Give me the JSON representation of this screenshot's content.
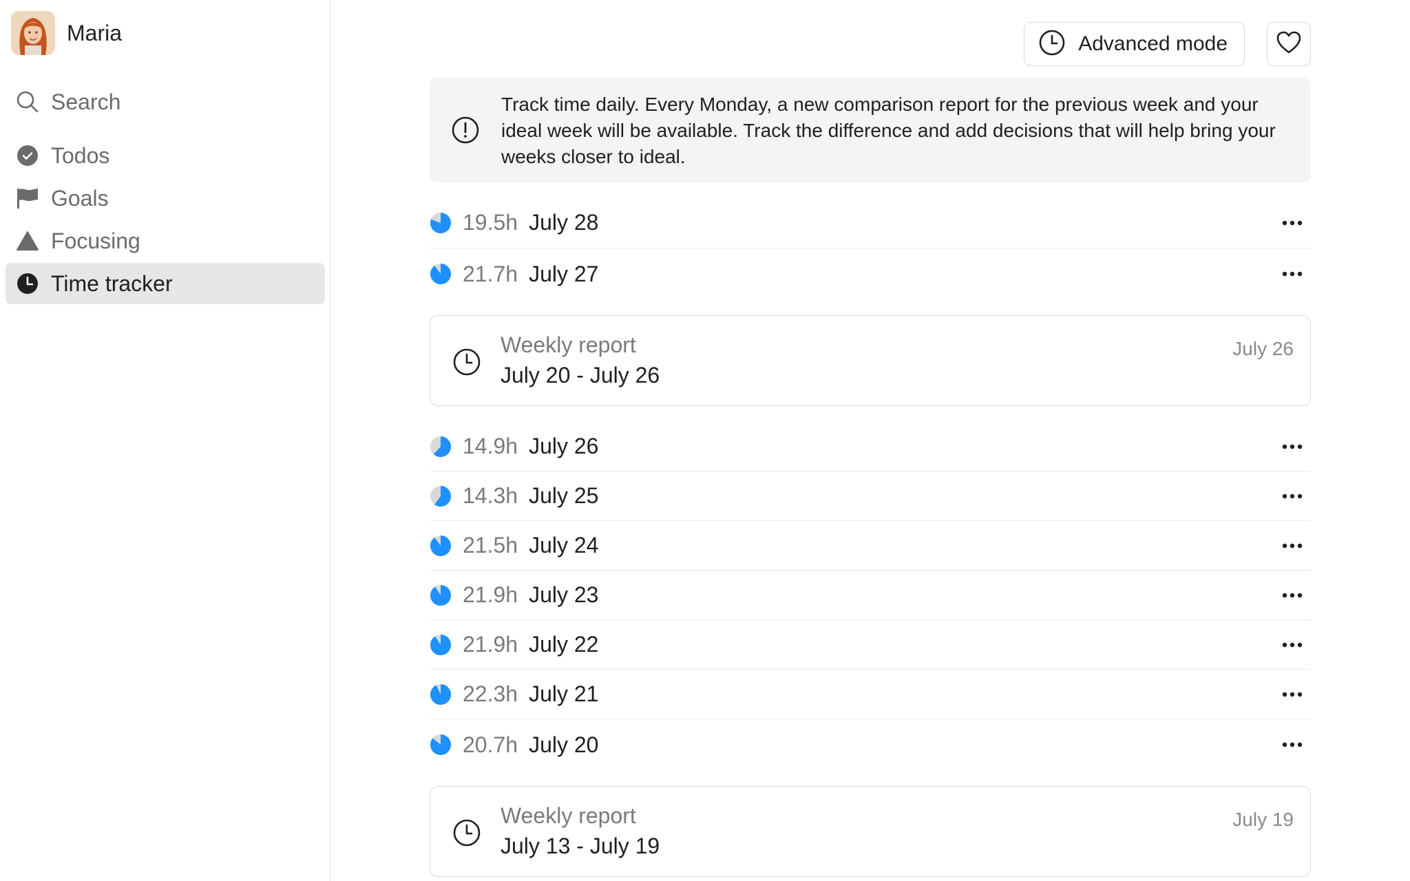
{
  "user": {
    "name": "Maria"
  },
  "nav": [
    {
      "label": "Search",
      "icon": "search-icon"
    },
    {
      "label": "Todos",
      "icon": "check-circle-icon"
    },
    {
      "label": "Goals",
      "icon": "flag-icon"
    },
    {
      "label": "Focusing",
      "icon": "triangle-icon"
    },
    {
      "label": "Time tracker",
      "icon": "clock-icon",
      "active": true
    }
  ],
  "toolbar": {
    "advanced_mode_label": "Advanced mode"
  },
  "info": {
    "text": "Track time daily. Every Monday, a new comparison report for the previous week and your ideal week will be available. Track the difference and add decisions that will help bring your weeks closer to ideal."
  },
  "days_top": [
    {
      "hours": "19.5h",
      "date": "July 28",
      "fill": 0.81
    },
    {
      "hours": "21.7h",
      "date": "July 27",
      "fill": 0.9
    }
  ],
  "report1": {
    "title": "Weekly report",
    "range": "July 20 - July 26",
    "date": "July 26"
  },
  "days_mid": [
    {
      "hours": "14.9h",
      "date": "July 26",
      "fill": 0.62
    },
    {
      "hours": "14.3h",
      "date": "July 25",
      "fill": 0.6
    },
    {
      "hours": "21.5h",
      "date": "July 24",
      "fill": 0.9
    },
    {
      "hours": "21.9h",
      "date": "July 23",
      "fill": 0.91
    },
    {
      "hours": "21.9h",
      "date": "July 22",
      "fill": 0.91
    },
    {
      "hours": "22.3h",
      "date": "July 21",
      "fill": 0.93
    },
    {
      "hours": "20.7h",
      "date": "July 20",
      "fill": 0.86
    }
  ],
  "report2": {
    "title": "Weekly report",
    "range": "July 13 - July 19",
    "date": "July 19"
  },
  "colors": {
    "accent": "#1E90FF",
    "pie_bg": "#D9D9D9"
  }
}
